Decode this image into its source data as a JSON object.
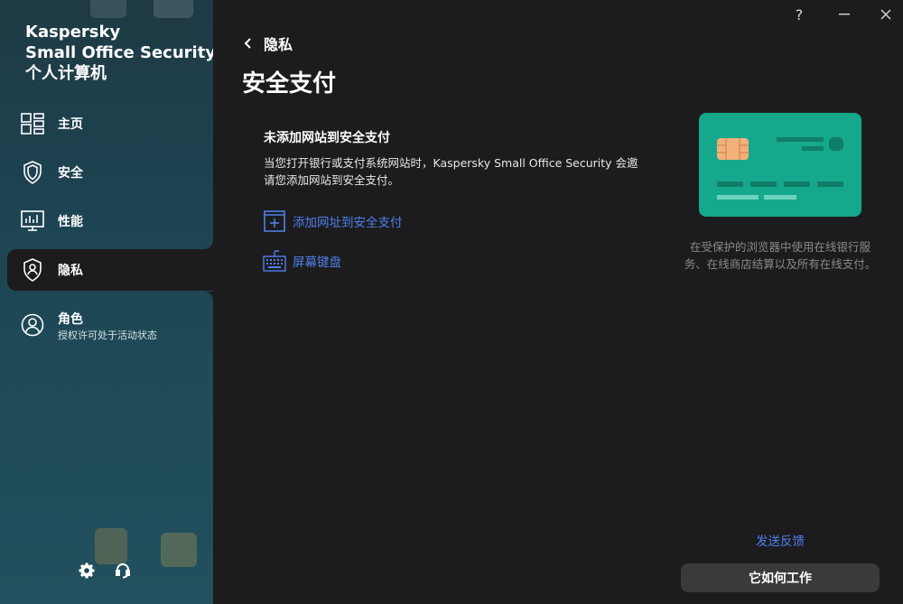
{
  "app": {
    "brand_line1": "Kaspersky",
    "brand_line2": "Small Office Security",
    "brand_line3": "个人计算机"
  },
  "window_controls": {
    "help": "?",
    "minimize": "–",
    "close": "✕"
  },
  "sidebar": {
    "items": [
      {
        "label": "主页",
        "icon": "home-grid-icon"
      },
      {
        "label": "安全",
        "icon": "shield-icon"
      },
      {
        "label": "性能",
        "icon": "performance-chart-icon"
      },
      {
        "label": "隐私",
        "icon": "privacy-shield-user-icon",
        "active": true
      },
      {
        "label": "角色",
        "sublabel": "授权许可处于活动状态",
        "icon": "user-circle-icon"
      }
    ],
    "footer": {
      "settings_icon": "gear-icon",
      "support_icon": "support-headset-icon"
    }
  },
  "main": {
    "back_label": "隐私",
    "page_title": "安全支付",
    "section_title": "未添加网站到安全支付",
    "description": "当您打开银行或支付系统网站时，Kaspersky Small Office Security 会邀请您添加网站到安全支付。",
    "actions": [
      {
        "label": "添加网址到安全支付",
        "icon": "add-url-icon"
      },
      {
        "label": "屏幕键盘",
        "icon": "keyboard-icon"
      }
    ]
  },
  "side_panel": {
    "illustration": "credit-card-icon",
    "description": "在受保护的浏览器中使用在线银行服务、在线商店结算以及所有在线支付。",
    "feedback_link": "发送反馈",
    "how_button": "它如何工作"
  },
  "colors": {
    "accent_link": "#4f7fe8",
    "card": "#16a88c",
    "background": "#1c1c1e"
  }
}
